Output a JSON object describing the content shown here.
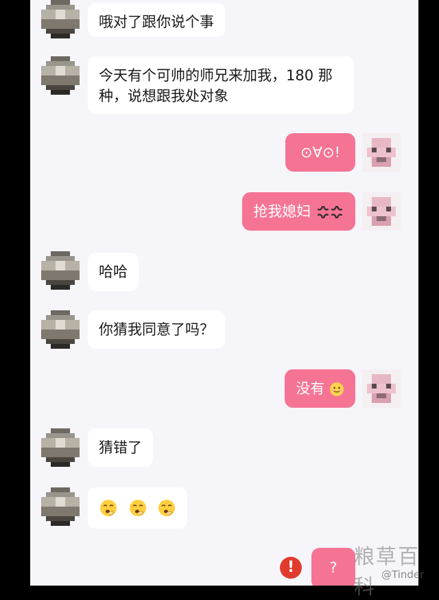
{
  "messages": [
    {
      "side": "in",
      "text": "哦对了跟你说个事"
    },
    {
      "side": "in",
      "text": "今天有个可帅的师兄来加我，180 那种，说想跟我处对象"
    },
    {
      "side": "out",
      "text": "⊙∀⊙!"
    },
    {
      "side": "out",
      "text": "抢我媳妇",
      "icon": "anger-symbol-icon"
    },
    {
      "side": "in",
      "text": "哈哈"
    },
    {
      "side": "in",
      "text": "你猜我同意了吗？"
    },
    {
      "side": "out",
      "text": "没有",
      "icon": "smile-emoji-icon"
    },
    {
      "side": "in",
      "text": "猜错了"
    },
    {
      "side": "in",
      "icons": [
        "yawn-emoji-icon",
        "yawn-emoji-icon",
        "yawn-emoji-icon"
      ]
    },
    {
      "side": "out",
      "text": "?",
      "status": "send-failed"
    }
  ],
  "watermark": {
    "text": "粮草百科",
    "credit": "@Tinder"
  },
  "colors": {
    "background": "#f6f5fa",
    "incoming_bubble": "#ffffff",
    "outgoing_bubble": "#f57494",
    "error": "#e23b2e"
  }
}
